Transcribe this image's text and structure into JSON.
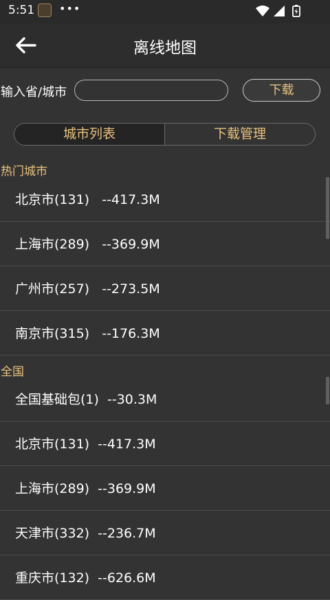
{
  "status_bar": {
    "time": "5:51",
    "dots": "•••"
  },
  "app_bar": {
    "title": "离线地图"
  },
  "search": {
    "label": "输入省/城市",
    "value": "",
    "button_label": "下载"
  },
  "tabs": [
    {
      "label": "城市列表"
    },
    {
      "label": "下载管理"
    }
  ],
  "sections": [
    {
      "header": "热门城市",
      "items": [
        {
          "text": "北京市(131)   --417.3M"
        },
        {
          "text": "上海市(289)   --369.9M"
        },
        {
          "text": "广州市(257)   --273.5M"
        },
        {
          "text": "南京市(315)   --176.3M"
        }
      ]
    },
    {
      "header": "全国",
      "items": [
        {
          "text": "全国基础包(1)  --30.3M"
        },
        {
          "text": "北京市(131)  --417.3M"
        },
        {
          "text": "上海市(289)  --369.9M"
        },
        {
          "text": "天津市(332)  --236.7M"
        },
        {
          "text": "重庆市(132)  --626.6M"
        }
      ]
    }
  ],
  "colors": {
    "accent": "#e8c27d",
    "background": "#333333",
    "divider": "#4b4b4b"
  }
}
